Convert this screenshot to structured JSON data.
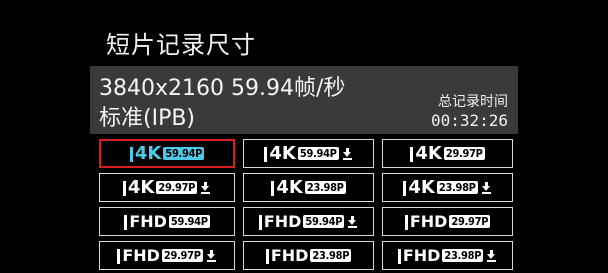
{
  "header": {
    "title": "短片记录尺寸"
  },
  "info": {
    "line1": "3840x2160 59.94帧/秒",
    "line2": "标准(IPB)",
    "total_label": "总记录时间",
    "total_value": "00:32:26"
  },
  "options": [
    {
      "res": "4K",
      "fps": "59.94P",
      "compressed": false,
      "selected": true
    },
    {
      "res": "4K",
      "fps": "59.94P",
      "compressed": true,
      "selected": false
    },
    {
      "res": "4K",
      "fps": "29.97P",
      "compressed": false,
      "selected": false
    },
    {
      "res": "4K",
      "fps": "29.97P",
      "compressed": true,
      "selected": false
    },
    {
      "res": "4K",
      "fps": "23.98P",
      "compressed": false,
      "selected": false
    },
    {
      "res": "4K",
      "fps": "23.98P",
      "compressed": true,
      "selected": false
    },
    {
      "res": "FHD",
      "fps": "59.94P",
      "compressed": false,
      "selected": false
    },
    {
      "res": "FHD",
      "fps": "59.94P",
      "compressed": true,
      "selected": false
    },
    {
      "res": "FHD",
      "fps": "29.97P",
      "compressed": false,
      "selected": false
    },
    {
      "res": "FHD",
      "fps": "29.97P",
      "compressed": true,
      "selected": false
    },
    {
      "res": "FHD",
      "fps": "23.98P",
      "compressed": false,
      "selected": false
    },
    {
      "res": "FHD",
      "fps": "23.98P",
      "compressed": true,
      "selected": false
    }
  ],
  "colors": {
    "selected_border": "#d81f1f",
    "selected_accent": "#4fc9e8",
    "info_panel_bg": "#3a3a3a"
  }
}
